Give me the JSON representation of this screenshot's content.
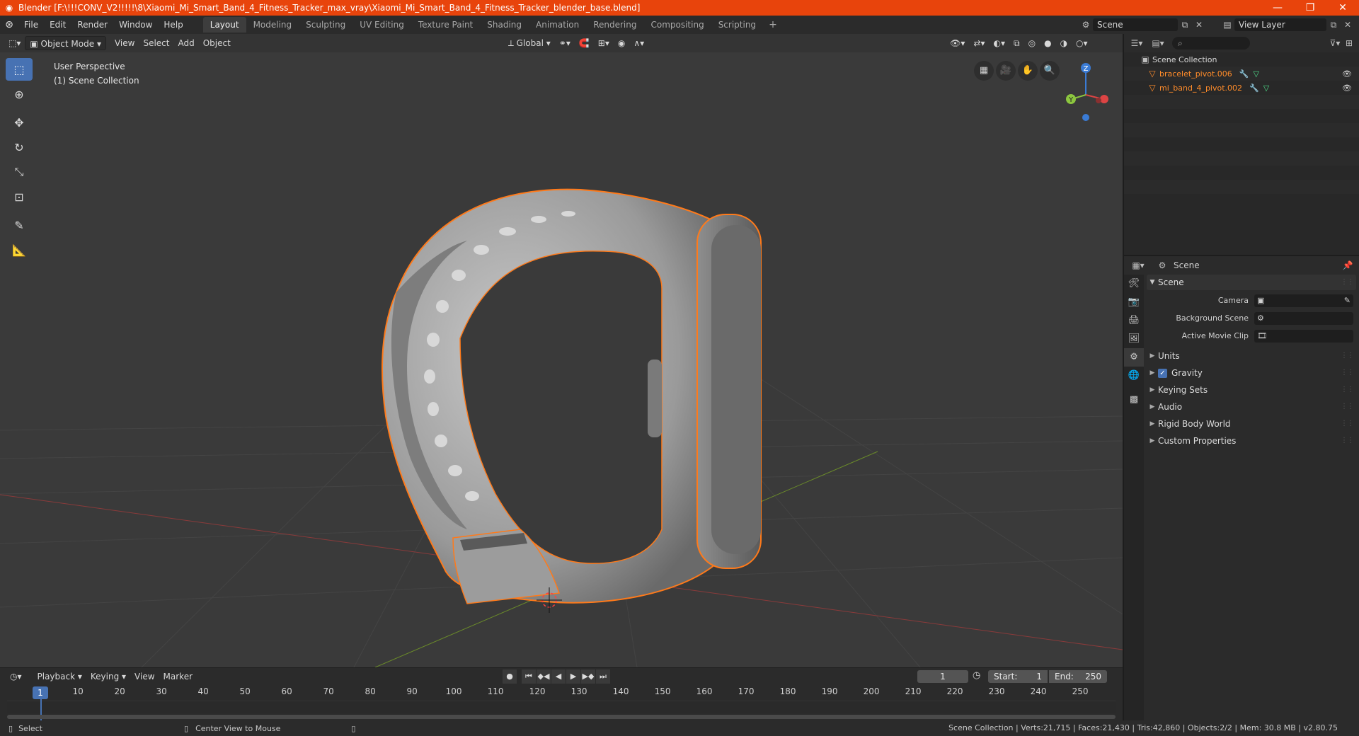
{
  "window": {
    "title": "Blender [F:\\!!!CONV_V2!!!!!\\8\\Xiaomi_Mi_Smart_Band_4_Fitness_Tracker_max_vray\\Xiaomi_Mi_Smart_Band_4_Fitness_Tracker_blender_base.blend]",
    "minimize": "—",
    "maximize": "❐",
    "close": "✕"
  },
  "menu": [
    "File",
    "Edit",
    "Render",
    "Window",
    "Help"
  ],
  "workspaces": [
    "Layout",
    "Modeling",
    "Sculpting",
    "UV Editing",
    "Texture Paint",
    "Shading",
    "Animation",
    "Rendering",
    "Compositing",
    "Scripting"
  ],
  "workspace_add": "+",
  "scene_field": "Scene",
  "view_layer_field": "View Layer",
  "viewport": {
    "mode": "Object Mode",
    "menus": [
      "View",
      "Select",
      "Add",
      "Object"
    ],
    "orientation": "Global",
    "info_line1": "User Perspective",
    "info_line2": "(1) Scene Collection"
  },
  "gizmo": {
    "z": "Z",
    "y": "Y"
  },
  "outliner": {
    "root": "Scene Collection",
    "items": [
      {
        "name": "bracelet_pivot.006"
      },
      {
        "name": "mi_band_4_pivot.002"
      }
    ]
  },
  "properties": {
    "header": "Scene",
    "panel": "Scene",
    "rows": [
      {
        "label": "Camera"
      },
      {
        "label": "Background Scene"
      },
      {
        "label": "Active Movie Clip"
      }
    ],
    "subpanels": {
      "units": "Units",
      "gravity": "Gravity",
      "keying_sets": "Keying Sets",
      "audio": "Audio",
      "rigid_body_world": "Rigid Body World",
      "custom_properties": "Custom Properties"
    }
  },
  "timeline": {
    "menus": [
      "Playback",
      "Keying",
      "View",
      "Marker"
    ],
    "current_frame": "1",
    "start_label": "Start:",
    "start_value": "1",
    "end_label": "End:",
    "end_value": "250",
    "ruler": [
      "10",
      "20",
      "30",
      "40",
      "50",
      "60",
      "70",
      "80",
      "90",
      "100",
      "110",
      "120",
      "130",
      "140",
      "150",
      "160",
      "170",
      "180",
      "190",
      "200",
      "210",
      "220",
      "230",
      "240",
      "250"
    ],
    "ruler_current": "1"
  },
  "status": {
    "select": "Select",
    "center": "Center View to Mouse",
    "info": "Scene Collection | Verts:21,715 | Faces:21,430 | Tris:42,860 | Objects:2/2 | Mem: 30.8 MB | v2.80.75"
  },
  "colors": {
    "titlebar": "#e8440c",
    "accent": "#4772b3",
    "selection_outline": "#ff8c2a"
  }
}
